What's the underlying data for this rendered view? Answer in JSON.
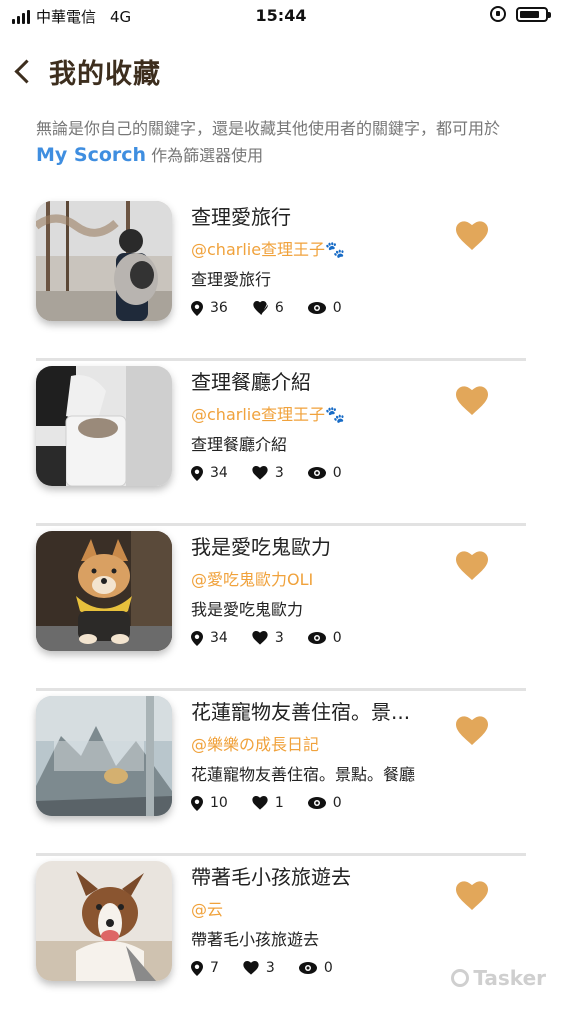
{
  "status": {
    "carrier": "中華電信",
    "network": "4G",
    "time": "15:44"
  },
  "header": {
    "title": "我的收藏"
  },
  "description": {
    "part1": "無論是你自己的關鍵字，還是收藏其他使用者的關鍵字，都可用於",
    "brand": "My Scorch",
    "part2": "作為篩選器使用"
  },
  "items": [
    {
      "title": "查理愛旅行",
      "author": "@charlie查理王子🐾",
      "subtitle": "查理愛旅行",
      "locations": "36",
      "likes": "6",
      "views": "0"
    },
    {
      "title": "查理餐廳介紹",
      "author": "@charlie查理王子🐾",
      "subtitle": "查理餐廳介紹",
      "locations": "34",
      "likes": "3",
      "views": "0"
    },
    {
      "title": "我是愛吃鬼歐力",
      "author": "@愛吃鬼歐力OLI",
      "subtitle": "我是愛吃鬼歐力",
      "locations": "34",
      "likes": "3",
      "views": "0"
    },
    {
      "title": "花蓮寵物友善住宿。景...",
      "author": "@樂樂の成長日記",
      "subtitle": "花蓮寵物友善住宿。景點。餐廳",
      "locations": "10",
      "likes": "1",
      "views": "0"
    },
    {
      "title": "帶著毛小孩旅遊去",
      "author": "@云",
      "subtitle": "帶著毛小孩旅遊去",
      "locations": "7",
      "likes": "3",
      "views": "0"
    }
  ],
  "watermark": "Tasker",
  "colors": {
    "accent": "#e2a75a",
    "author": "#f0a23c",
    "brand": "#3f8ee0",
    "title": "#3d2e1e"
  }
}
